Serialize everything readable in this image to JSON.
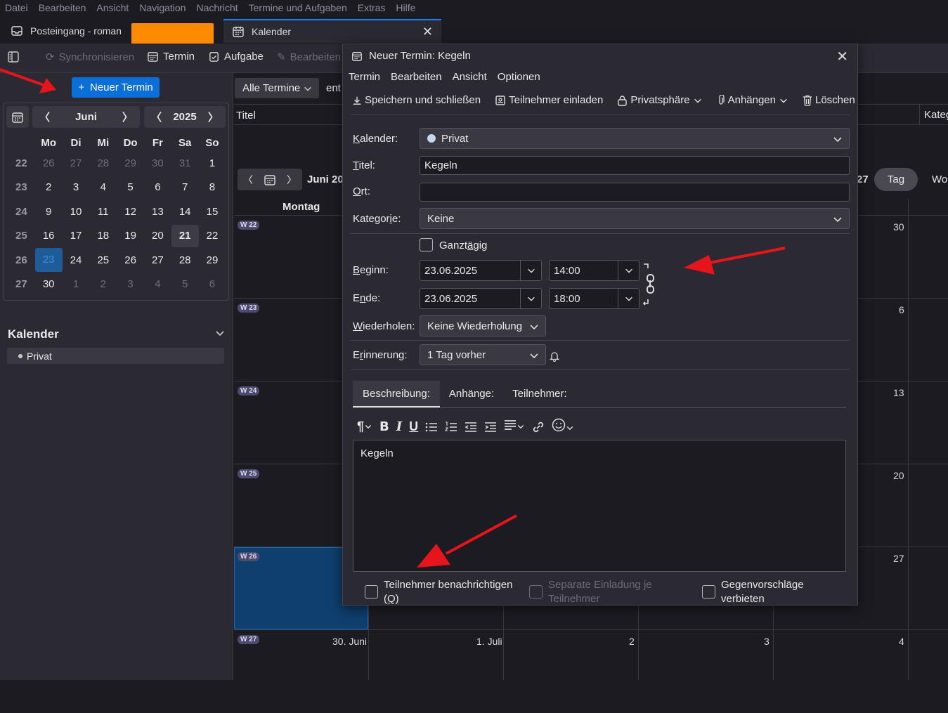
{
  "menubar": [
    "Datei",
    "Bearbeiten",
    "Ansicht",
    "Navigation",
    "Nachricht",
    "Termine und Aufgaben",
    "Extras",
    "Hilfe"
  ],
  "tabs": {
    "inbox": "Posteingang - roman",
    "calendar": "Kalender"
  },
  "toolbar": {
    "sync": "Synchronisieren",
    "event": "Termin",
    "task": "Aufgabe",
    "edit": "Bearbeiten"
  },
  "sidebar": {
    "new_event": "Neuer Termin",
    "month": "Juni",
    "year": "2025",
    "weekdays": [
      "Mo",
      "Di",
      "Mi",
      "Do",
      "Fr",
      "Sa",
      "So"
    ],
    "weeks": [
      {
        "wk": "22",
        "days": [
          "26",
          "27",
          "28",
          "29",
          "30",
          "31",
          "1"
        ]
      },
      {
        "wk": "23",
        "days": [
          "2",
          "3",
          "4",
          "5",
          "6",
          "7",
          "8"
        ]
      },
      {
        "wk": "24",
        "days": [
          "9",
          "10",
          "11",
          "12",
          "13",
          "14",
          "15"
        ]
      },
      {
        "wk": "25",
        "days": [
          "16",
          "17",
          "18",
          "19",
          "20",
          "21",
          "22"
        ]
      },
      {
        "wk": "26",
        "days": [
          "23",
          "24",
          "25",
          "26",
          "27",
          "28",
          "29"
        ]
      },
      {
        "wk": "27",
        "days": [
          "30",
          "1",
          "2",
          "3",
          "4",
          "5",
          "6"
        ]
      }
    ],
    "calendars_heading": "Kalender",
    "calendar_item": "Privat"
  },
  "main": {
    "filter": "Alle Termine",
    "search_partial": "ent",
    "col_title": "Titel",
    "col_category": "Kateg",
    "month_label": "Juni 20",
    "range_end": "27",
    "view_day": "Tag",
    "view_week": "Wo",
    "day_header": "Montag",
    "weeks": [
      {
        "badge": "W 22",
        "right": "30"
      },
      {
        "badge": "W 23",
        "right": "6"
      },
      {
        "badge": "W 24",
        "right": "13"
      },
      {
        "badge": "W 25",
        "right": "20"
      },
      {
        "badge": "W 26",
        "right": "27"
      },
      {
        "badge": "W 27",
        "d1": "30. Juni",
        "d2": "1. Juli",
        "d3": "2",
        "d4": "3",
        "d5": "4"
      }
    ]
  },
  "dialog": {
    "title": "Neuer Termin: Kegeln",
    "menu": [
      "Termin",
      "Bearbeiten",
      "Ansicht",
      "Optionen"
    ],
    "tools": {
      "save": "Speichern und schließen",
      "invite": "Teilnehmer einladen",
      "privacy": "Privatsphäre",
      "attach": "Anhängen",
      "delete": "Löschen"
    },
    "labels": {
      "calendar": "Kalender:",
      "title": "Titel:",
      "location": "Ort:",
      "category": "Kategorie:",
      "allday": "Ganztägig",
      "start": "Beginn:",
      "end": "Ende:",
      "repeat": "Wiederholen:",
      "reminder": "Erinnerung:"
    },
    "values": {
      "calendar": "Privat",
      "title": "Kegeln",
      "location": "",
      "category": "Keine",
      "start_date": "23.06.2025",
      "start_time": "14:00",
      "end_date": "23.06.2025",
      "end_time": "18:00",
      "repeat": "Keine Wiederholung",
      "reminder": "1 Tag vorher"
    },
    "tabs": [
      "Beschreibung:",
      "Anhänge:",
      "Teilnehmer:"
    ],
    "description": "Kegeln",
    "footer": {
      "notify": "Teilnehmer benachrichtigen",
      "notify_key": "(Q)",
      "separate": "Separate Einladung je Teilnehmer",
      "counter": "Gegenvorschläge verbieten"
    }
  },
  "colors": {
    "accent": "#0a84ff",
    "button": "#0a6fd8",
    "annotation_arrow": "#e8141c",
    "redaction": "#ff8a00"
  }
}
